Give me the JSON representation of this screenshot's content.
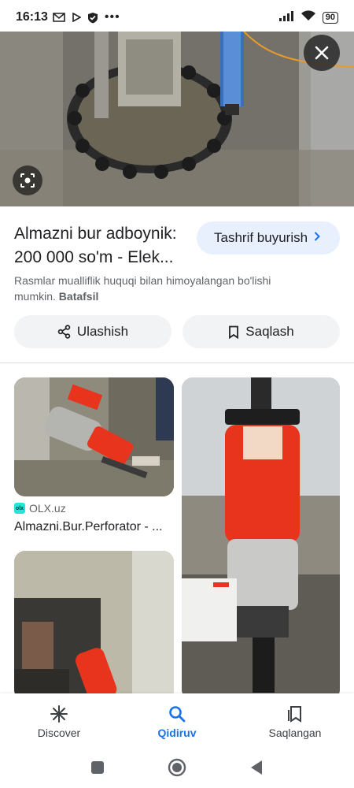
{
  "status_bar": {
    "time": "16:13",
    "battery": "90"
  },
  "hero": {
    "close_icon": "close-icon",
    "lens_icon": "lens-icon"
  },
  "result": {
    "title": "Almazni bur adboynik: 200 000 so'm - Elek...",
    "visit_label": "Tashrif buyurish",
    "copyright_text": "Rasmlar mualliflik huquqi bilan himoyalangan bo'lishi mumkin.",
    "copyright_link": "Batafsil",
    "share_label": "Ulashish",
    "save_label": "Saqlash"
  },
  "related": {
    "items": [
      {
        "source": "OLX.uz",
        "title": "Almazni.Bur.Perforator - ..."
      }
    ]
  },
  "bottom_nav": {
    "items": [
      {
        "label": "Discover",
        "icon": "discover-icon"
      },
      {
        "label": "Qidiruv",
        "icon": "search-icon"
      },
      {
        "label": "Saqlangan",
        "icon": "saved-icon"
      }
    ]
  },
  "colors": {
    "accent": "#1a73e8",
    "visit_bg": "#e8f0fe",
    "pill_bg": "#f1f3f4",
    "drill_red": "#e8341c"
  }
}
